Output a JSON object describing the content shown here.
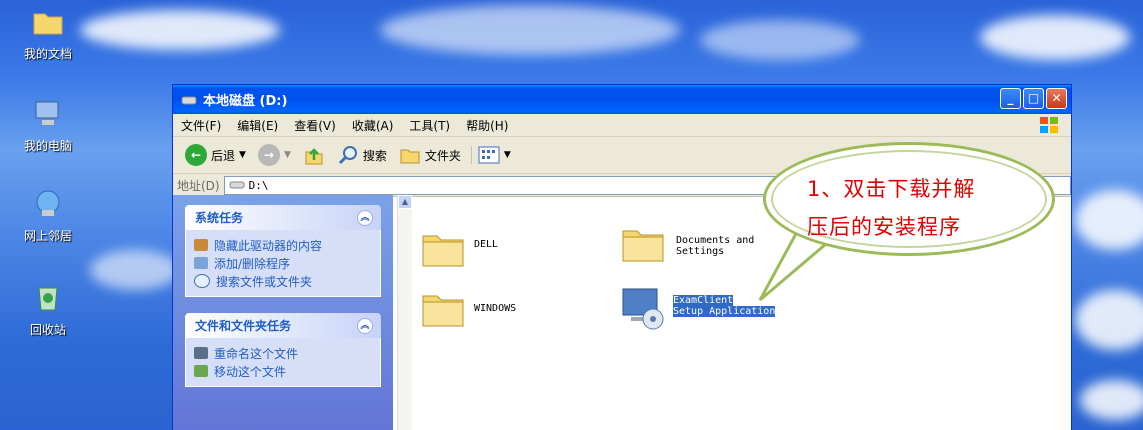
{
  "desktop": {
    "icons": [
      {
        "label": "我的文档"
      },
      {
        "label": "我的电脑"
      },
      {
        "label": "网上邻居"
      },
      {
        "label": "回收站"
      }
    ]
  },
  "window": {
    "title": "本地磁盘 (D:)",
    "menu": [
      "文件(F)",
      "编辑(E)",
      "查看(V)",
      "收藏(A)",
      "工具(T)",
      "帮助(H)"
    ],
    "toolbar": {
      "back_label": "后退",
      "search_label": "搜索",
      "folders_label": "文件夹"
    },
    "address": {
      "label": "地址(D)",
      "value": "D:\\"
    },
    "system_tasks": {
      "title": "系统任务",
      "items": [
        "隐藏此驱动器的内容",
        "添加/删除程序",
        "搜索文件或文件夹"
      ]
    },
    "file_tasks": {
      "title": "文件和文件夹任务",
      "items": [
        "重命名这个文件",
        "移动这个文件"
      ]
    },
    "files": [
      {
        "name_line1": "DELL",
        "name_line2": ""
      },
      {
        "name_line1": "Documents and",
        "name_line2": "Settings"
      },
      {
        "name_line1": "WINDOWS",
        "name_line2": ""
      },
      {
        "name_line1": "ExamClient",
        "name_line2": "Setup Application"
      }
    ]
  },
  "callout": {
    "line1": "1、双击下载并解",
    "line2": "压后的安装程序",
    "text_color": "#e00000",
    "border_color": "#9bbb59"
  },
  "colors": {
    "titlebar": "#0053ee",
    "selection": "#316ac5",
    "task_link": "#215dc6"
  }
}
